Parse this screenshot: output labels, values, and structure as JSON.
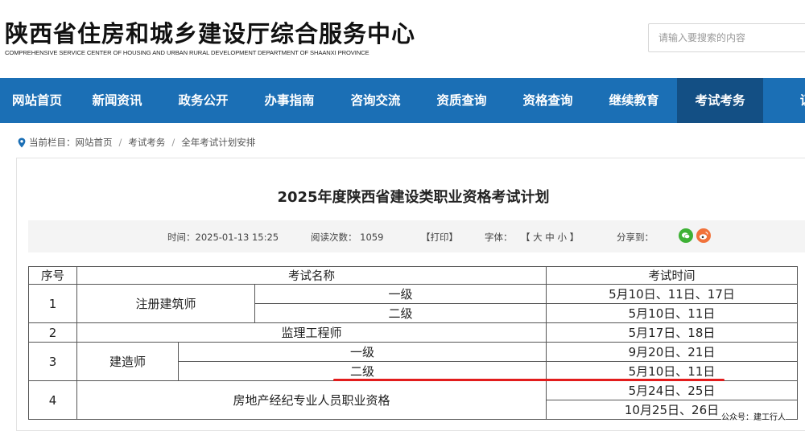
{
  "header": {
    "title": "陕西省住房和城乡建设厅综合服务中心",
    "subtitle": "COMPREHENSIVE SERVICE CENTER OF HOUSING AND URBAN RURAL DEVELOPMENT DEPARTMENT OF SHAANXI PROVINCE",
    "search_placeholder": "请输入要搜索的内容"
  },
  "nav": {
    "items": [
      "网站首页",
      "新闻资讯",
      "政务公开",
      "办事指南",
      "咨询交流",
      "资质查询",
      "资格查询",
      "继续教育",
      "考试考务",
      "证"
    ],
    "active_index": 8
  },
  "breadcrumb": {
    "label": "当前栏目：",
    "items": [
      "网站首页",
      "考试考务",
      "全年考试计划安排"
    ],
    "separator": "/"
  },
  "article": {
    "title": "2025年度陕西省建设类职业资格考试计划",
    "time": "时间：2025-01-13 15:25",
    "views": "阅读次数：  1059",
    "print": "【打印】",
    "font_label": "字体：",
    "font_sizes": "【 大  中  小 】",
    "share_label": "分享到：",
    "share_icons": [
      "wechat-icon",
      "weibo-icon"
    ]
  },
  "table": {
    "headers": [
      "序号",
      "考试名称",
      "考试时间"
    ],
    "rows": [
      {
        "no": "1",
        "name": "注册建筑师",
        "sub": [
          "一级",
          "二级"
        ],
        "times": [
          "5月10日、11日、17日",
          "5月10日、11日"
        ]
      },
      {
        "no": "2",
        "name": "监理工程师",
        "times": [
          "5月17日、18日"
        ]
      },
      {
        "no": "3",
        "name": "建造师",
        "sub": [
          "一级",
          "二级"
        ],
        "times": [
          "9月20日、21日",
          "5月10日、11日"
        ]
      },
      {
        "no": "4",
        "name": "房地产经纪专业人员职业资格",
        "times": [
          "5月24日、25日",
          "10月25日、26日"
        ]
      }
    ]
  },
  "watermark": "公众号：建工行人",
  "colors": {
    "nav_bg": "#1b6fb5",
    "nav_active": "#134f84",
    "highlight": "#e21c1c"
  }
}
